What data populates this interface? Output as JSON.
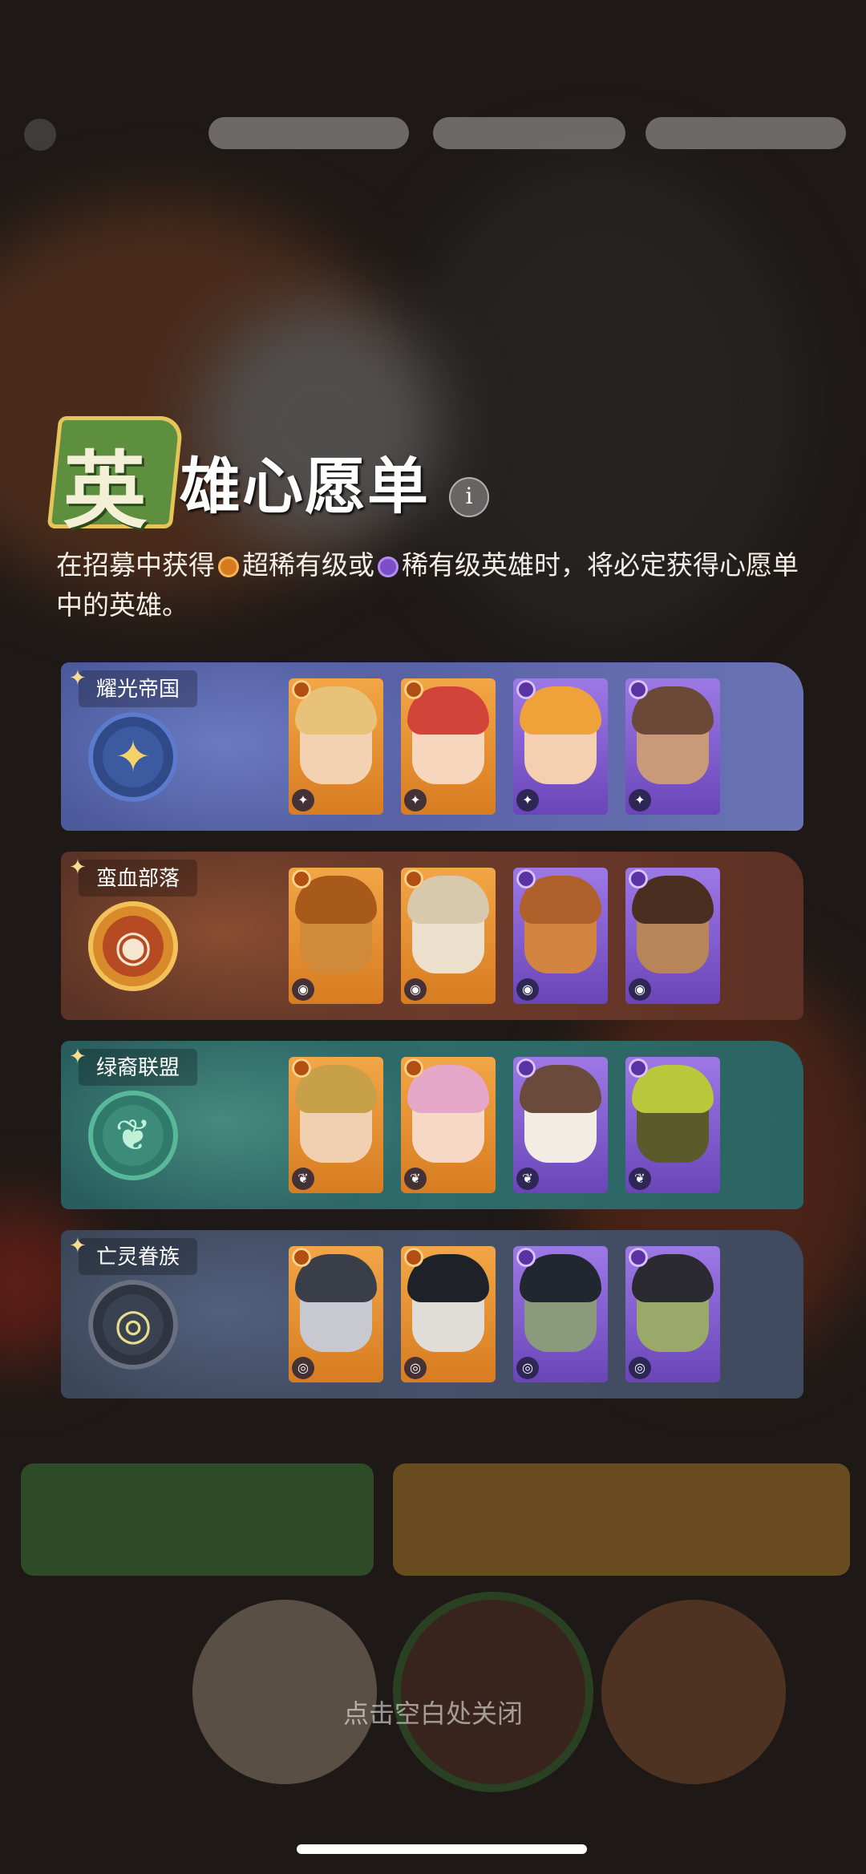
{
  "title": {
    "badge_char": "英",
    "rest": "雄心愿单",
    "info_label": "i"
  },
  "description": {
    "part1": "在招募中获得",
    "part2": "超稀有级或",
    "part3": "稀有级英雄时，将必定获得心愿单中的英雄。"
  },
  "factions": [
    {
      "name": "耀光帝国",
      "heroes": [
        "orange",
        "orange",
        "purple",
        "purple"
      ],
      "accent": "#f4d36a"
    },
    {
      "name": "蛮血部落",
      "heroes": [
        "orange",
        "orange",
        "purple",
        "purple"
      ],
      "accent": "#e8a24a"
    },
    {
      "name": "绿裔联盟",
      "heroes": [
        "orange",
        "orange",
        "purple",
        "purple"
      ],
      "accent": "#8ee0b0"
    },
    {
      "name": "亡灵眷族",
      "heroes": [
        "orange",
        "orange",
        "purple",
        "purple"
      ],
      "accent": "#d4d084"
    }
  ],
  "close_hint": "点击空白处关闭",
  "colors": {
    "super_rare": "#d77a1f",
    "rare": "#7c4fc8"
  }
}
